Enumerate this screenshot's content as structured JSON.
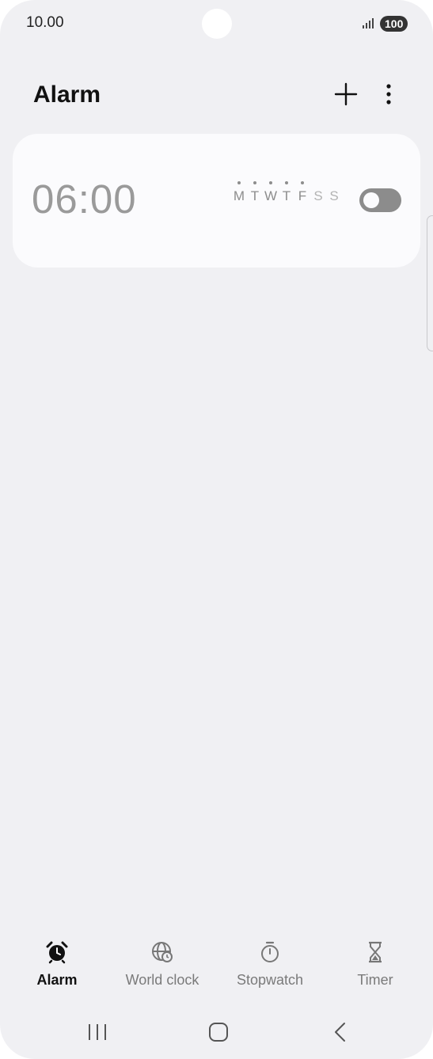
{
  "status_bar": {
    "time": "10.00",
    "battery": "100"
  },
  "header": {
    "title": "Alarm",
    "add_icon": "plus-icon",
    "more_icon": "more-vertical-icon"
  },
  "alarms": [
    {
      "time": "06:00",
      "enabled": false,
      "days": [
        {
          "letter": "M",
          "active": true
        },
        {
          "letter": "T",
          "active": true
        },
        {
          "letter": "W",
          "active": true
        },
        {
          "letter": "T",
          "active": true
        },
        {
          "letter": "F",
          "active": true
        },
        {
          "letter": "S",
          "active": false
        },
        {
          "letter": "S",
          "active": false
        }
      ]
    }
  ],
  "bottom_nav": [
    {
      "label": "Alarm",
      "icon": "alarm-clock-icon",
      "active": true
    },
    {
      "label": "World clock",
      "icon": "globe-clock-icon",
      "active": false
    },
    {
      "label": "Stopwatch",
      "icon": "stopwatch-icon",
      "active": false
    },
    {
      "label": "Timer",
      "icon": "hourglass-icon",
      "active": false
    }
  ],
  "system_nav": {
    "recents_icon": "recents-icon",
    "home_icon": "home-icon",
    "back_icon": "back-icon"
  },
  "colors": {
    "background": "#f0f0f3",
    "card": "#fbfbfd",
    "toggle_off": "#8c8c8c",
    "text_primary": "#111111",
    "text_secondary": "#7a7a7a"
  }
}
